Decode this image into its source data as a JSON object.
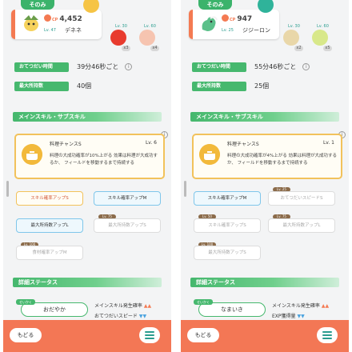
{
  "colors": {
    "accent": "#f47a52",
    "green": "#46b86e",
    "gold": "#f2c25b",
    "blue": "#7fc6ea",
    "bottom_bar": "#f37755"
  },
  "panels": [
    {
      "tab_label": "そのみ",
      "cp_prefix": "CP",
      "cp": "4,452",
      "level": "Lv. 47",
      "name": "デネネ",
      "ingredients": [
        {
          "color": "#f6c445",
          "level": "",
          "count": ""
        },
        {
          "color": "#e83b2e",
          "level": "Lv. 30",
          "count": "x3"
        },
        {
          "color": "#f6c4b0",
          "level": "Lv. 60",
          "count": "x4"
        }
      ],
      "stats": [
        {
          "label": "おてつだい時間",
          "value": "39分46秒ごと"
        },
        {
          "label": "最大所持数",
          "value": "40個"
        }
      ],
      "skills_header": "メインスキル・サブスキル",
      "main_skill": {
        "name": "料理チャンスS",
        "level": "Lv. 6",
        "description": "料理の大成功確率が10%上がる 効果は料理が大成功するか、 フィールドを移動するまで持続する"
      },
      "sub_skills": [
        {
          "label": "スキル確率アップS",
          "style": "gold",
          "tag": ""
        },
        {
          "label": "スキル確率アップM",
          "style": "blue",
          "tag": ""
        },
        {
          "label": "最大所持数アップL",
          "style": "blue",
          "tag": ""
        },
        {
          "label": "最大所持数アップS",
          "style": "gray",
          "tag": "Lv. 75"
        },
        {
          "label": "食材確率アップM",
          "style": "gray",
          "tag": "Lv. 100"
        }
      ],
      "details_header": "詳細ステータス",
      "nature_label": "せいかく",
      "nature": "おだやか",
      "effects": [
        {
          "text": "メインスキル発生確率",
          "arrows": "▲▲",
          "dir": "up"
        },
        {
          "text": "おてつだいスピード",
          "arrows": "▼▼",
          "dir": "down"
        }
      ],
      "back_label": "もどる"
    },
    {
      "tab_label": "そのみ",
      "cp_prefix": "CP",
      "cp": "947",
      "level": "Lv. 25",
      "name": "ジジーロン",
      "ingredients": [
        {
          "color": "#2fb39a",
          "level": "",
          "count": ""
        },
        {
          "color": "#e9d7a9",
          "level": "Lv. 30",
          "count": "x2"
        },
        {
          "color": "#d8e88a",
          "level": "Lv. 60",
          "count": "x5"
        }
      ],
      "stats": [
        {
          "label": "おてつだい時間",
          "value": "55分46秒ごと"
        },
        {
          "label": "最大所持数",
          "value": "25個"
        }
      ],
      "skills_header": "メインスキル・サブスキル",
      "main_skill": {
        "name": "料理チャンスS",
        "level": "Lv. 1",
        "description": "料理の大成功確率が4%上がる 効果は料理が大成功するか、 フィールドを移動するまで持続する"
      },
      "sub_skills": [
        {
          "label": "スキル確率アップM",
          "style": "blue",
          "tag": ""
        },
        {
          "label": "おてつだいスピードS",
          "style": "gray",
          "tag": "Lv. 25"
        },
        {
          "label": "スキル確率アップS",
          "style": "gray",
          "tag": "Lv. 50"
        },
        {
          "label": "最大所持数アップL",
          "style": "gray",
          "tag": "Lv. 75"
        },
        {
          "label": "最大所持数アップS",
          "style": "gray",
          "tag": "Lv. 100"
        }
      ],
      "details_header": "詳細ステータス",
      "nature_label": "せいかく",
      "nature": "なまいき",
      "effects": [
        {
          "text": "メインスキル発生確率",
          "arrows": "▲▲",
          "dir": "up"
        },
        {
          "text": "EXP獲得量",
          "arrows": "▼▼",
          "dir": "down"
        }
      ],
      "back_label": "もどる"
    }
  ]
}
